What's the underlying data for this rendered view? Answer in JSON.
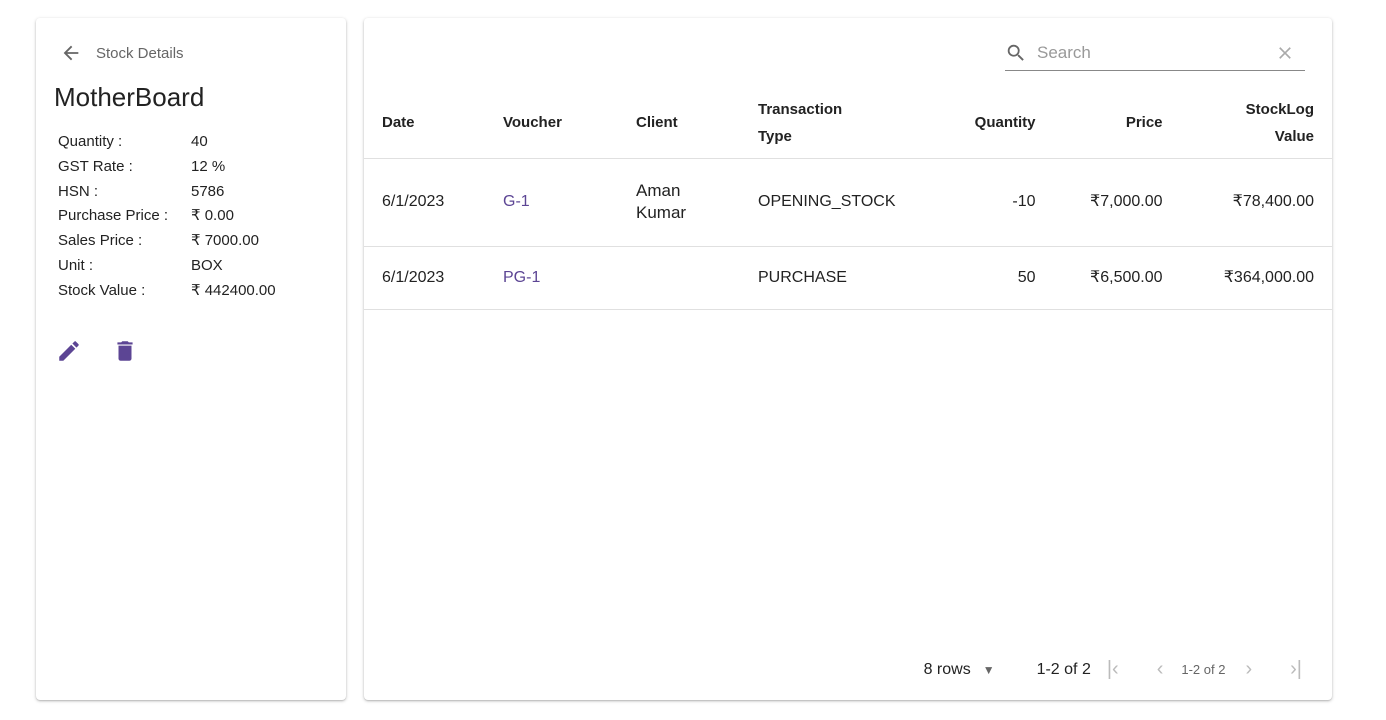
{
  "header": {
    "back_label": "Stock Details",
    "title": "MotherBoard"
  },
  "details": [
    {
      "label": "Quantity :",
      "value": "40"
    },
    {
      "label": "GST Rate :",
      "value": "12 %"
    },
    {
      "label": "HSN :",
      "value": "5786"
    },
    {
      "label": "Purchase Price :",
      "value": "₹ 0.00"
    },
    {
      "label": "Sales Price :",
      "value": "₹ 7000.00"
    },
    {
      "label": "Unit :",
      "value": "BOX"
    },
    {
      "label": "Stock Value :",
      "value": "₹ 442400.00"
    }
  ],
  "search": {
    "placeholder": "Search",
    "value": ""
  },
  "table": {
    "columns": [
      "Date",
      "Voucher",
      "Client",
      "Transaction Type",
      "Quantity",
      "Price",
      "StockLog Value"
    ],
    "rows": [
      {
        "date": "6/1/2023",
        "voucher": "G-1",
        "client": "Aman Kumar",
        "type": "OPENING_STOCK",
        "quantity": "-10",
        "price": "₹7,000.00",
        "value": "₹78,400.00"
      },
      {
        "date": "6/1/2023",
        "voucher": "PG-1",
        "client": "",
        "type": "PURCHASE",
        "quantity": "50",
        "price": "₹6,500.00",
        "value": "₹364,000.00"
      }
    ]
  },
  "pagination": {
    "rows_label": "8 rows",
    "range": "1-2 of 2",
    "range_small": "1-2 of 2"
  },
  "colors": {
    "accent": "#5c4594"
  }
}
